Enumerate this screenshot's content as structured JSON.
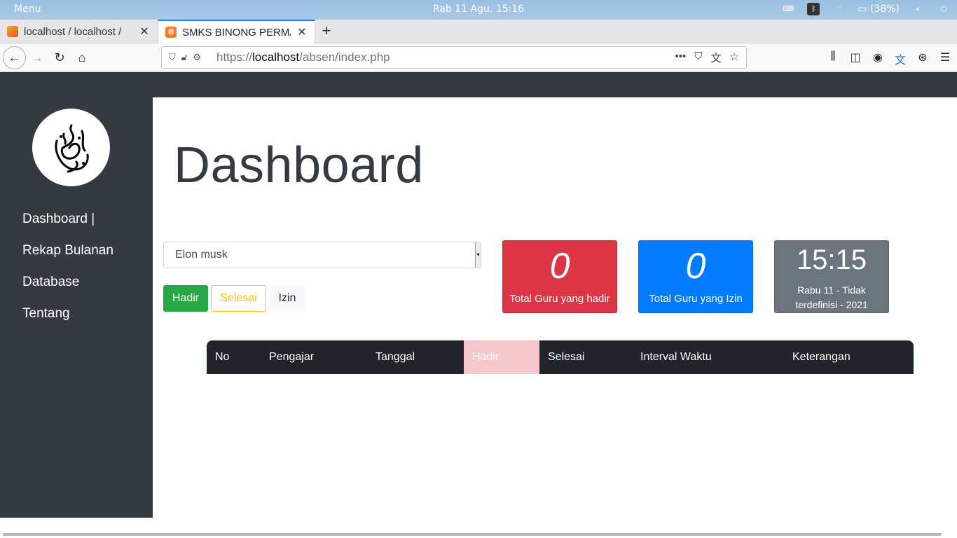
{
  "os": {
    "menu_label": "Menu",
    "clock": "Rab 11 Agu, 15:16",
    "battery": "(38%)"
  },
  "tabs": [
    {
      "title": "localhost / localhost /",
      "active": false
    },
    {
      "title": "SMKS BINONG PERMAI",
      "active": true
    }
  ],
  "nav": {
    "url_scheme": "https://",
    "url_host": "localhost",
    "url_path": "/absen/index.php"
  },
  "sidebar": {
    "items": [
      {
        "label": "Dashboard |"
      },
      {
        "label": "Rekap Bulanan"
      },
      {
        "label": "Database"
      },
      {
        "label": "Tentang"
      }
    ]
  },
  "main": {
    "title": "Dashboard",
    "select_value": "Elon musk",
    "buttons": {
      "hadir": "Hadir",
      "selesai": "Selesai",
      "izin": "Izin"
    },
    "cards": {
      "hadir_count": "0",
      "hadir_label": "Total Guru yang hadir",
      "izin_count": "0",
      "izin_label": "Total Guru yang Izin",
      "clock_time": "15:15",
      "clock_date": "Rabu 11 - Tidak terdefinisi - 2021"
    },
    "table": {
      "headers": [
        "No",
        "Pengajar",
        "Tanggal",
        "Hadir",
        "Selesai",
        "Interval Waktu",
        "Keterangan"
      ]
    }
  },
  "colors": {
    "dark": "#343a40",
    "success": "#28a745",
    "warning": "#ffc107",
    "danger": "#dc3545",
    "primary": "#007bff",
    "secondary": "#6c757d"
  }
}
